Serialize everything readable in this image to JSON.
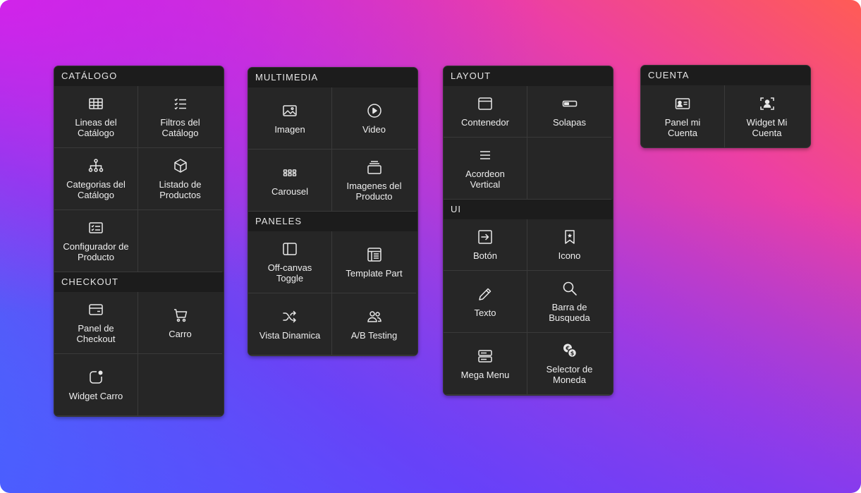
{
  "panels": {
    "catalogo": {
      "header": "CATÁLOGO",
      "items": [
        {
          "label": "Lineas del\nCatálogo",
          "icon": "table-grid-icon"
        },
        {
          "label": "Filtros del\nCatálogo",
          "icon": "checklist-icon"
        },
        {
          "label": "Categorias del\nCatálogo",
          "icon": "sitemap-icon"
        },
        {
          "label": "Listado de\nProductos",
          "icon": "cube-icon"
        },
        {
          "label": "Configurador de\nProducto",
          "icon": "list-card-icon"
        }
      ]
    },
    "checkout": {
      "header": "CHECKOUT",
      "items": [
        {
          "label": "Panel de\nCheckout",
          "icon": "credit-card-icon"
        },
        {
          "label": "Carro",
          "icon": "shopping-cart-icon"
        },
        {
          "label": "Widget Carro",
          "icon": "notification-badge-icon"
        }
      ]
    },
    "multimedia": {
      "header": "MULTIMEDIA",
      "items": [
        {
          "label": "Imagen",
          "icon": "image-icon"
        },
        {
          "label": "Video",
          "icon": "play-circle-icon"
        },
        {
          "label": "Carousel",
          "icon": "dots-grid-icon"
        },
        {
          "label": "Imagenes del\nProducto",
          "icon": "stacked-layers-icon"
        }
      ]
    },
    "paneles": {
      "header": "PANELES",
      "items": [
        {
          "label": "Off-canvas\nToggle",
          "icon": "sidebar-panel-icon"
        },
        {
          "label": "Template Part",
          "icon": "template-layout-icon"
        },
        {
          "label": "Vista Dinamica",
          "icon": "shuffle-icon"
        },
        {
          "label": "A/B Testing",
          "icon": "users-icon"
        }
      ]
    },
    "layout": {
      "header": "LAYOUT",
      "items": [
        {
          "label": "Contenedor",
          "icon": "container-window-icon"
        },
        {
          "label": "Solapas",
          "icon": "tabs-toggle-icon"
        },
        {
          "label": "Acordeon\nVertical",
          "icon": "menu-lines-icon"
        }
      ]
    },
    "ui": {
      "header": "UI",
      "items": [
        {
          "label": "Botón",
          "icon": "login-arrow-icon"
        },
        {
          "label": "Icono",
          "icon": "bookmark-star-icon"
        },
        {
          "label": "Texto",
          "icon": "pencil-icon"
        },
        {
          "label": "Barra de\nBusqueda",
          "icon": "search-icon"
        },
        {
          "label": "Mega Menu",
          "icon": "server-stack-icon"
        },
        {
          "label": "Selector de\nMoneda",
          "icon": "currency-exchange-icon"
        }
      ]
    },
    "cuenta": {
      "header": "CUENTA",
      "items": [
        {
          "label": "Panel mi\nCuenta",
          "icon": "id-card-icon"
        },
        {
          "label": "Widget Mi\nCuenta",
          "icon": "user-scan-icon"
        }
      ]
    }
  }
}
